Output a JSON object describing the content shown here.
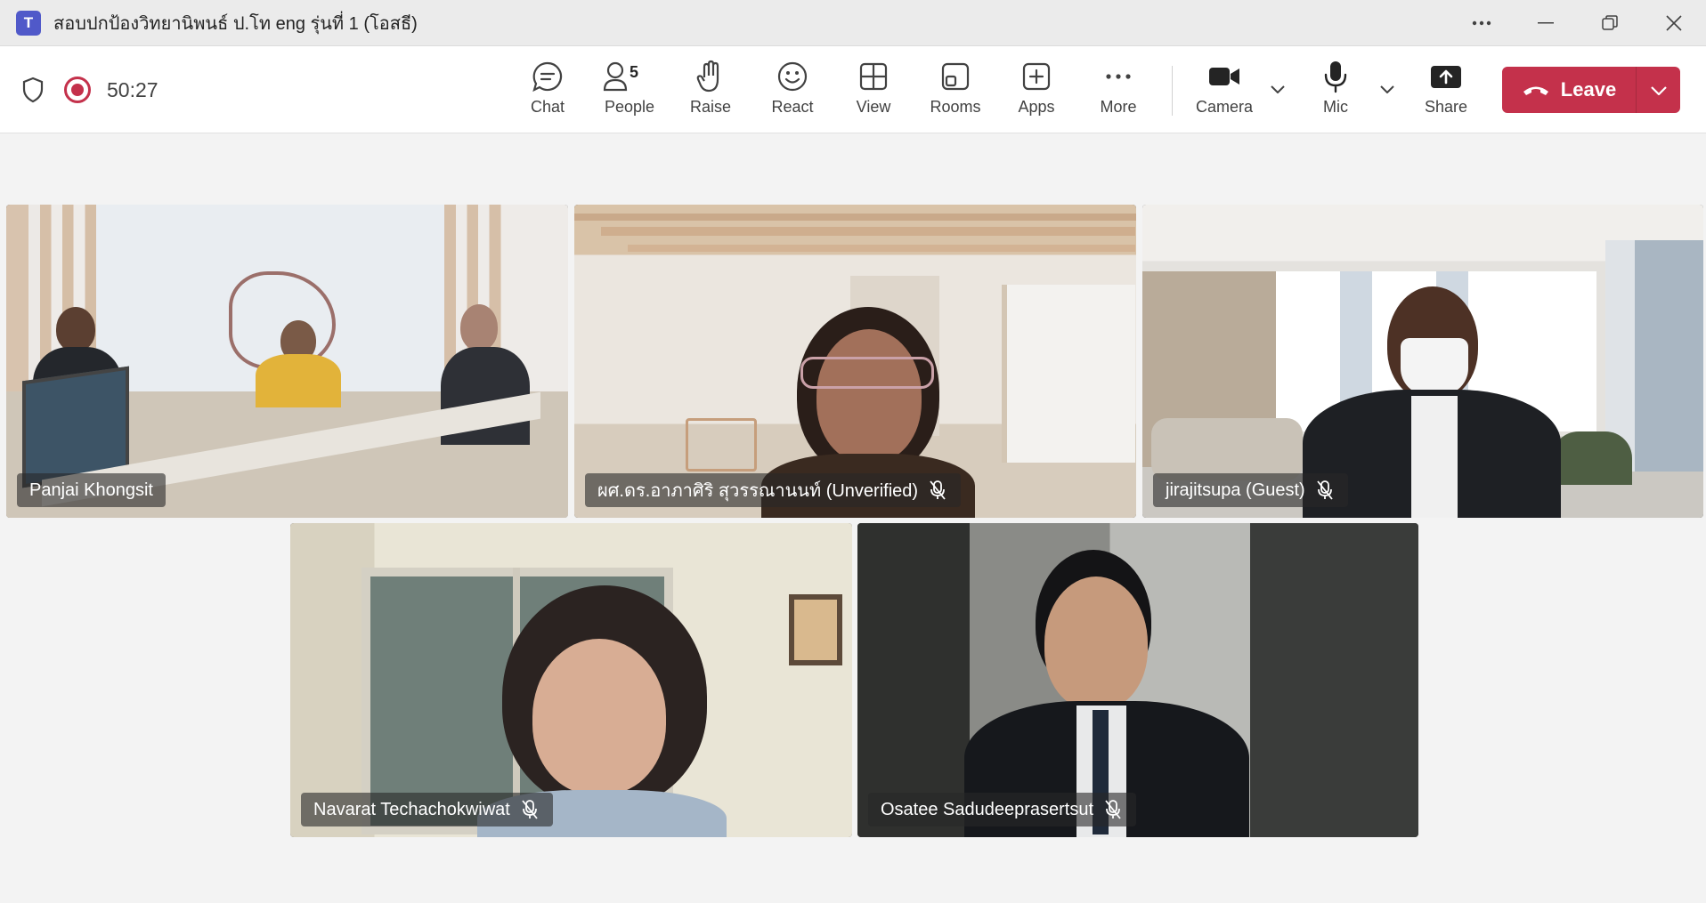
{
  "window": {
    "title": "สอบปกป้องวิทยานิพนธ์ ป.โท eng รุ่นที่ 1 (โอสธี)",
    "app_icon_letter": "T"
  },
  "status": {
    "timer": "50:27"
  },
  "toolbar": {
    "chat": "Chat",
    "people": "People",
    "people_count": "5",
    "raise": "Raise",
    "react": "React",
    "view": "View",
    "rooms": "Rooms",
    "apps": "Apps",
    "more": "More",
    "camera": "Camera",
    "mic": "Mic",
    "share": "Share",
    "leave": "Leave"
  },
  "participants": [
    {
      "name": "Panjai Khongsit",
      "muted": false
    },
    {
      "name": "ผศ.ดร.อาภาศิริ สุวรรณานนท์ (Unverified)",
      "muted": true
    },
    {
      "name": "jirajitsupa (Guest)",
      "muted": true
    },
    {
      "name": "Navarat Techachokwiwat",
      "muted": true
    },
    {
      "name": "Osatee Sadudeeprasertsut",
      "muted": true
    }
  ],
  "colors": {
    "leave_red": "#c4314b",
    "teams_purple": "#5059c9",
    "recording_red": "#c4314b"
  }
}
